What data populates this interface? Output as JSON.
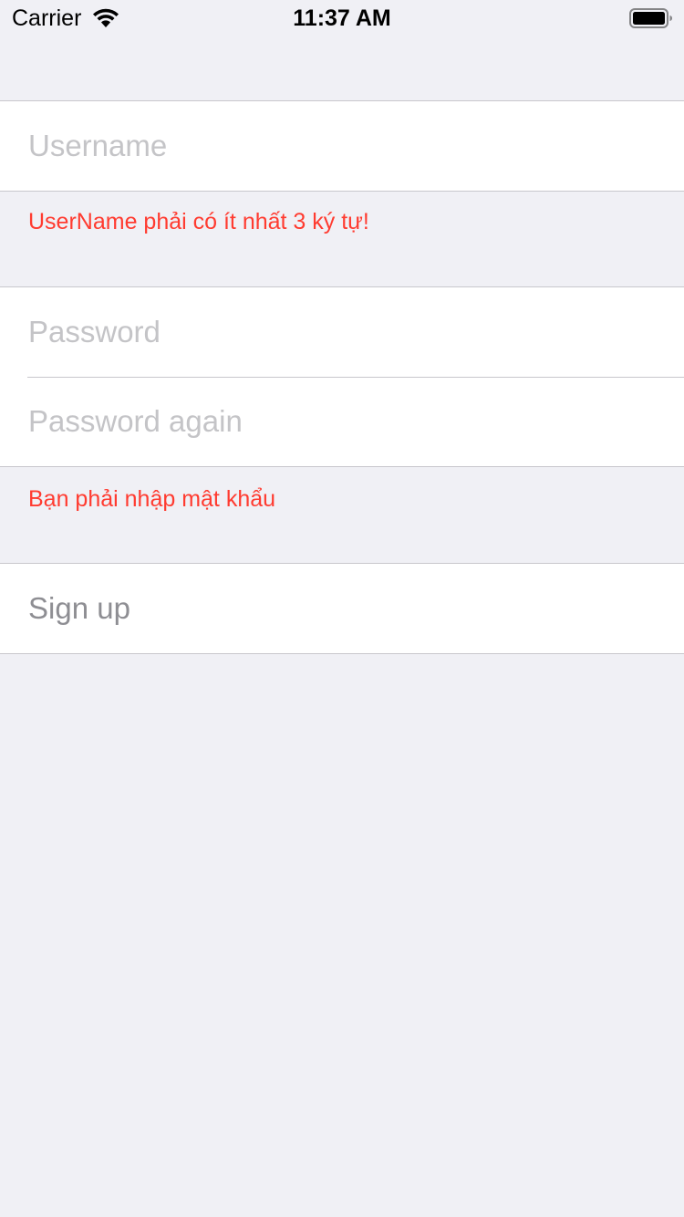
{
  "status_bar": {
    "carrier": "Carrier",
    "time": "11:37 AM",
    "icons": [
      "wifi-icon",
      "battery-icon"
    ]
  },
  "form": {
    "username": {
      "value": "",
      "placeholder": "Username"
    },
    "username_error": "UserName phải có ít nhất 3 ký tự!",
    "password": {
      "value": "",
      "placeholder": "Password"
    },
    "password_again": {
      "value": "",
      "placeholder": "Password again"
    },
    "password_error": "Bạn phải nhập mật khẩu",
    "signup_label": "Sign up"
  },
  "colors": {
    "background": "#F0F0F5",
    "cell": "#FFFFFF",
    "separator": "#C8C7CC",
    "error": "#FF3B30",
    "placeholder": "#C4C4C7",
    "disabled_text": "#8E8E93"
  }
}
